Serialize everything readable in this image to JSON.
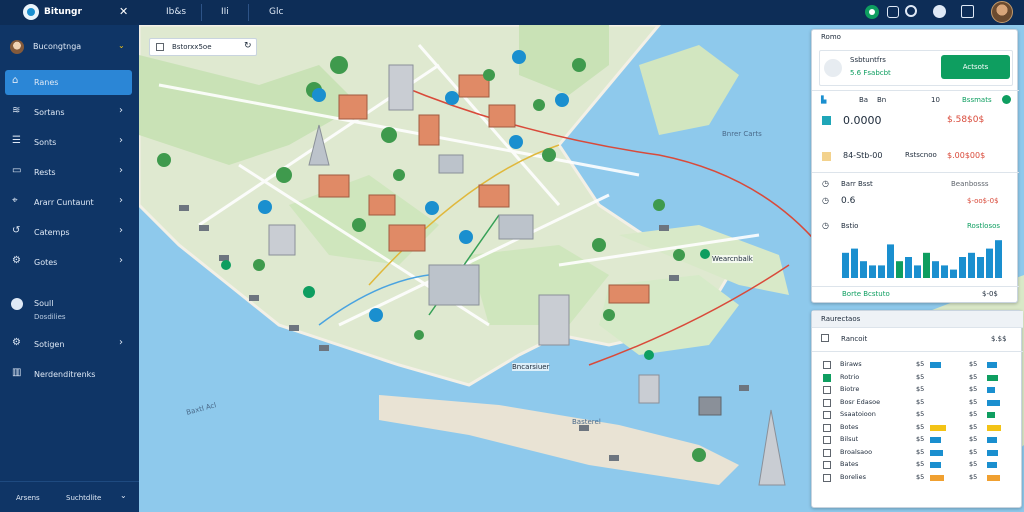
{
  "app": {
    "title": "Bitungr",
    "close_label": "✕",
    "tabs": [
      "Ib&s",
      "IIi",
      "Glc"
    ]
  },
  "sidebar": {
    "profile_label": "Bucongtnga",
    "items": [
      {
        "label": "Ranes",
        "icon": "home-icon",
        "active": true
      },
      {
        "label": "Sortans",
        "icon": "layers-icon"
      },
      {
        "label": "Sonts",
        "icon": "list-icon"
      },
      {
        "label": "Rests",
        "icon": "folder-icon"
      },
      {
        "label": "Ararr Cuntaunt",
        "icon": "pin-icon"
      },
      {
        "label": "Catemps",
        "icon": "route-icon"
      },
      {
        "label": "Gotes",
        "icon": "settings-icon"
      }
    ],
    "section_title": "Soull",
    "section_sub": "Dosdilies",
    "items2": [
      {
        "label": "Sotigen",
        "icon": "gear-icon"
      },
      {
        "label": "Nerdenditrenks",
        "icon": "chart-icon"
      }
    ],
    "footer_left": "Arsens",
    "footer_right": "Suchtdlite"
  },
  "map": {
    "search_text": "Bstorxx5oe",
    "labels": [
      "Bnrer Carts",
      "Wearcnbalk",
      "Baxtl Acl",
      "Bncarsiuer",
      "Basterel"
    ],
    "accent_green": "#0e9e60",
    "accent_blue": "#1a8fcf"
  },
  "top_panel": {
    "title": "Romo",
    "card_title": "Ssbtuntfrs",
    "card_sub": "5.6 Fsabcbt",
    "action_label": "Actsots",
    "stats_header": [
      "Ba",
      "Bn",
      "10",
      "Bssmats"
    ],
    "stats": [
      {
        "label": "0.0000",
        "value": "$.58$0$",
        "color": "#1fa6b8"
      },
      {
        "label": "84-Stb-00",
        "mid": "Rstscnoo",
        "value": "$.00$00$",
        "color": "#f3d28d"
      }
    ],
    "lines": [
      {
        "label": "Barr Bsst",
        "value": "Beanbosss"
      },
      {
        "label": "0.6",
        "value": "$-oo$-0$"
      }
    ],
    "chart_label": "Bstio",
    "chart_note": "Rostlosos",
    "footer_left": "Borte Bcstuto",
    "footer_right": "$-0$"
  },
  "chart_data": {
    "type": "bar",
    "values": [
      6,
      7,
      4,
      3,
      3,
      8,
      4,
      5,
      3,
      6,
      4,
      3,
      2,
      5,
      6,
      5,
      7,
      9
    ],
    "colors": [
      "#1a8fcf",
      "#1a8fcf",
      "#1a8fcf",
      "#1a8fcf",
      "#1a8fcf",
      "#1a8fcf",
      "#0e9e60",
      "#1a8fcf",
      "#1a8fcf",
      "#0e9e60",
      "#1a8fcf",
      "#1a8fcf",
      "#1a8fcf",
      "#1a8fcf",
      "#1a8fcf",
      "#1a8fcf",
      "#1a8fcf",
      "#1a8fcf"
    ],
    "ylim": [
      0,
      10
    ]
  },
  "bottom_panel": {
    "title": "Raurectaos",
    "search_label": "Rancoit",
    "search_value": "$.$$",
    "header": [
      "",
      "",
      "",
      ""
    ],
    "rows": [
      {
        "name": "Biraws",
        "a": "$5",
        "b": "$5",
        "bar": 0.6,
        "color": "#1a8fcf"
      },
      {
        "name": "Rotrio",
        "a": "$5",
        "b": "$5",
        "bar": 0.7,
        "color": "#0e9e60",
        "checked": true
      },
      {
        "name": "Biotre",
        "a": "$5",
        "b": "$5",
        "bar": 0.5,
        "color": "#1a8fcf"
      },
      {
        "name": "Bosr Edasoe",
        "a": "$5",
        "b": "$5",
        "bar": 0.8,
        "color": "#1a8fcf"
      },
      {
        "name": "Ssaatoioon",
        "a": "$5",
        "b": "$5",
        "bar": 0.5,
        "color": "#0e9e60"
      },
      {
        "name": "Botes",
        "a": "$5",
        "b": "$5",
        "bar": 0.9,
        "color": "#f3c316"
      },
      {
        "name": "Bilsut",
        "a": "$5",
        "b": "$5",
        "bar": 0.6,
        "color": "#1a8fcf"
      },
      {
        "name": "Broalsaoo",
        "a": "$5",
        "b": "$5",
        "bar": 0.7,
        "color": "#1a8fcf"
      },
      {
        "name": "Bates",
        "a": "$5",
        "b": "$5",
        "bar": 0.6,
        "color": "#1a8fcf"
      },
      {
        "name": "Borelies",
        "a": "$5",
        "b": "$5",
        "bar": 0.8,
        "color": "#f0a030"
      }
    ]
  }
}
